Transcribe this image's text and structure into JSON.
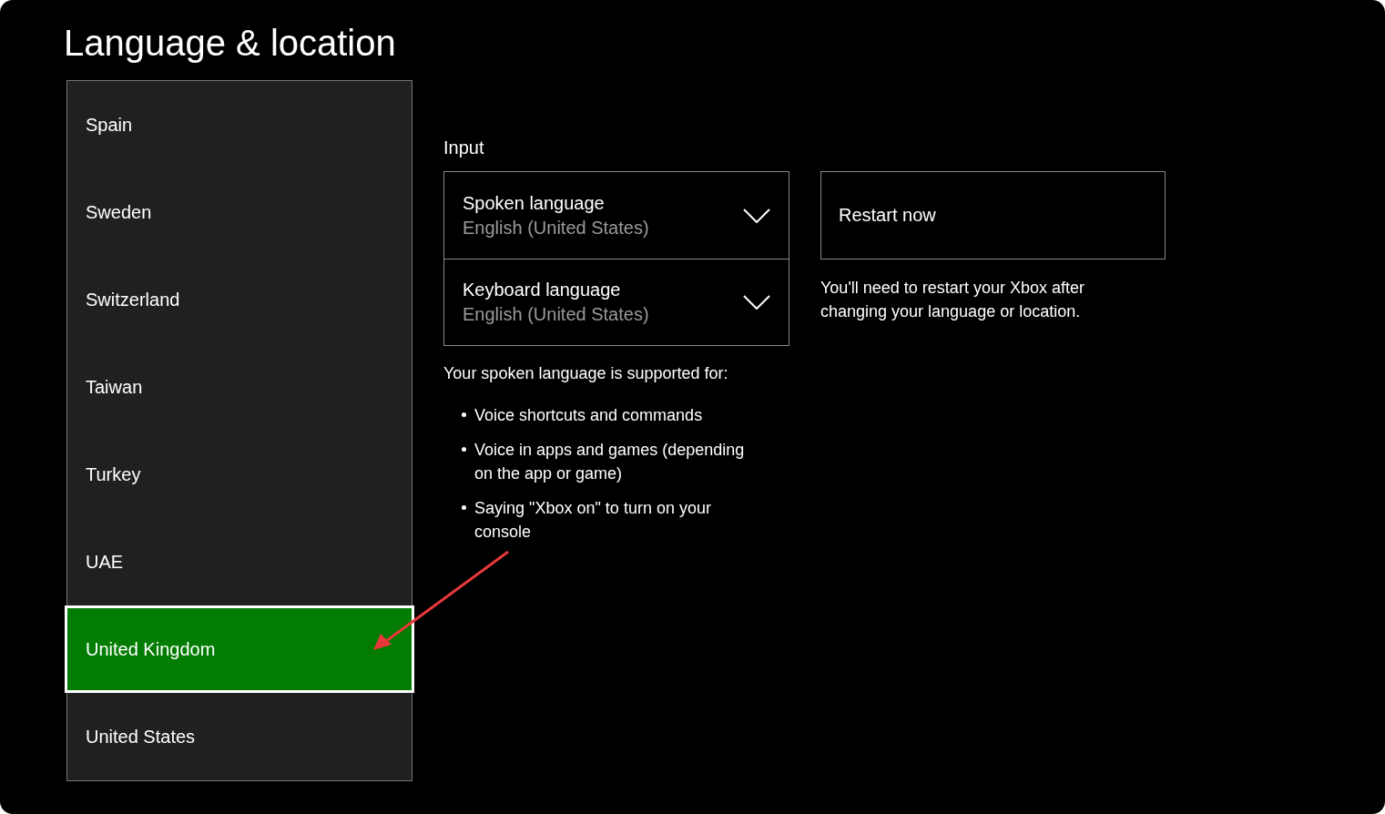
{
  "page": {
    "title": "Language & location"
  },
  "regions": [
    {
      "label": "Spain",
      "selected": false
    },
    {
      "label": "Sweden",
      "selected": false
    },
    {
      "label": "Switzerland",
      "selected": false
    },
    {
      "label": "Taiwan",
      "selected": false
    },
    {
      "label": "Turkey",
      "selected": false
    },
    {
      "label": "UAE",
      "selected": false
    },
    {
      "label": "United Kingdom",
      "selected": true
    },
    {
      "label": "United States",
      "selected": false
    }
  ],
  "input": {
    "heading": "Input",
    "dropdowns": [
      {
        "label": "Spoken language",
        "value": "English (United States)"
      },
      {
        "label": "Keyboard language",
        "value": "English (United States)"
      }
    ],
    "support_text": "Your spoken language is supported for:",
    "support_items": [
      "Voice shortcuts and commands",
      "Voice in apps and games (depending on the app or game)",
      "Saying \"Xbox on\" to turn on your console"
    ]
  },
  "restart": {
    "button": "Restart now",
    "note": "You'll need to restart your Xbox after changing your language or location."
  }
}
